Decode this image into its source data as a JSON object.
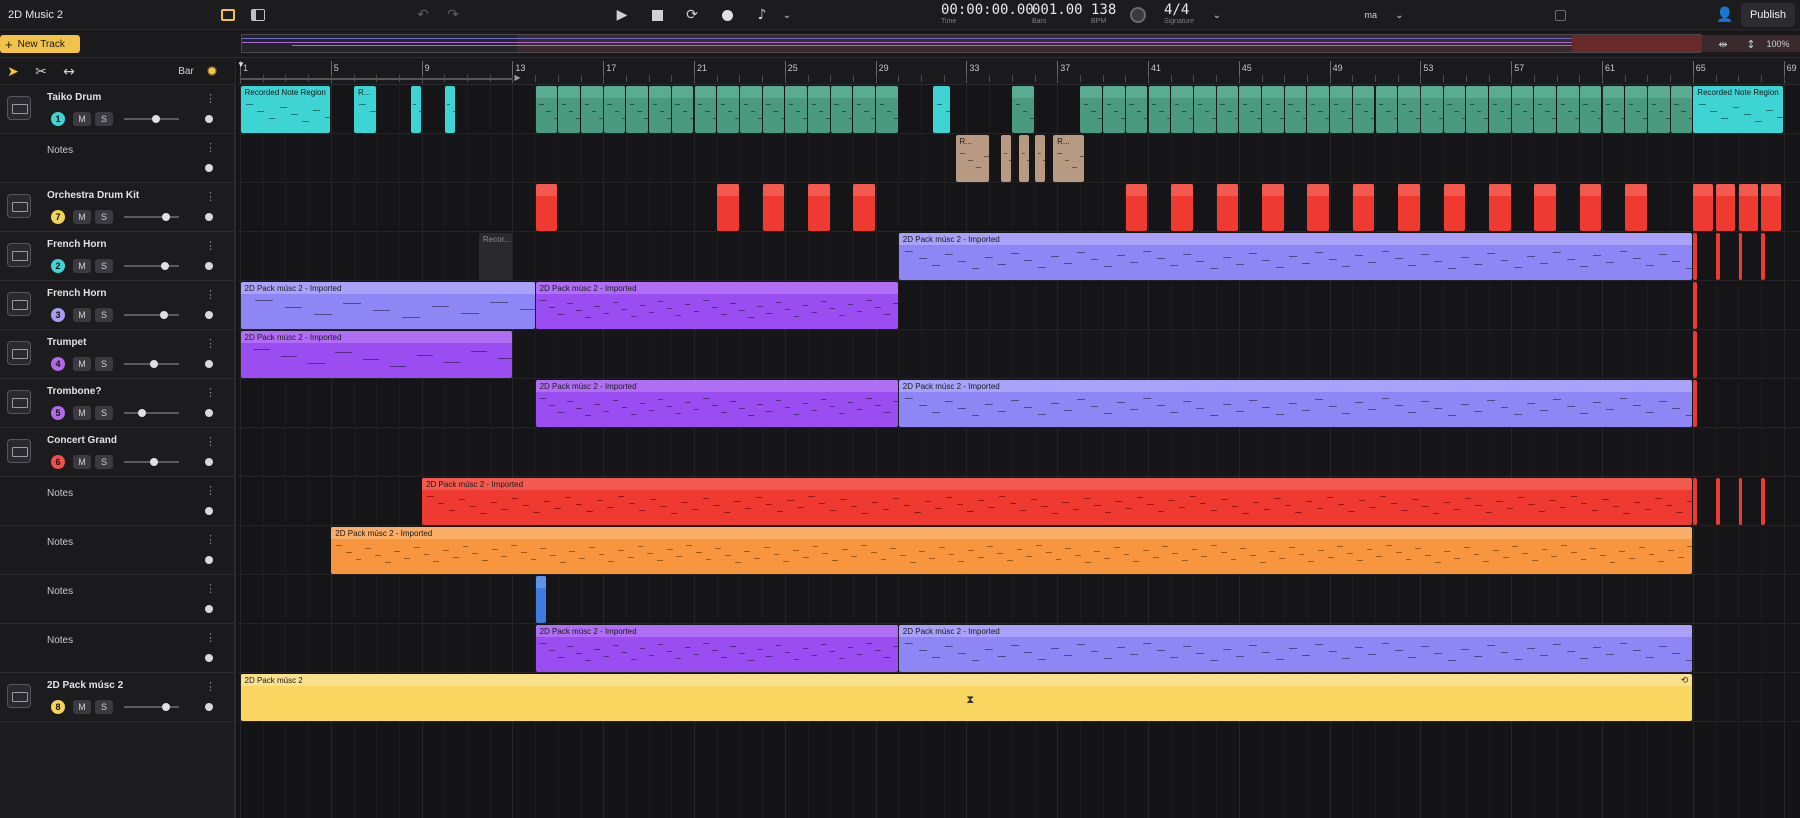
{
  "app": {
    "title": "2D Music 2",
    "publish": "Publish"
  },
  "transport": {
    "time": "00:00:00.00",
    "time_label": "Time",
    "bars": "001.00",
    "bars_label": "Bars",
    "bpm": "138",
    "bpm_label": "BPM",
    "signature": "4/4",
    "signature_label": "Signature",
    "key": "ma"
  },
  "zoom": "100%",
  "new_track": "New Track",
  "snap": "Bar",
  "ruler": [
    "1",
    "5",
    "9",
    "13",
    "17",
    "21",
    "25",
    "29",
    "33",
    "37",
    "41",
    "45",
    "49",
    "53",
    "57",
    "61",
    "65",
    "69"
  ],
  "tracks": [
    {
      "name": "Taiko Drum",
      "num": "1",
      "num_color": "#3fd4d4",
      "icon": true,
      "vol": 0.55
    },
    {
      "name": "Notes",
      "sub": true
    },
    {
      "name": "Orchestra Drum Kit",
      "num": "7",
      "num_color": "#f2d45a",
      "icon": true,
      "vol": 0.75
    },
    {
      "name": "French Horn",
      "num": "2",
      "num_color": "#3fd4d4",
      "icon": true,
      "vol": 0.72
    },
    {
      "name": "French Horn",
      "num": "3",
      "num_color": "#a99cf5",
      "icon": true,
      "vol": 0.7
    },
    {
      "name": "Trumpet",
      "num": "4",
      "num_color": "#b06ae8",
      "icon": true,
      "vol": 0.5
    },
    {
      "name": "Trombone?",
      "num": "5",
      "num_color": "#b06ae8",
      "icon": true,
      "vol": 0.28
    },
    {
      "name": "Concert Grand",
      "num": "6",
      "num_color": "#ef5048",
      "icon": true,
      "vol": 0.5
    },
    {
      "name": "Notes",
      "sub": true
    },
    {
      "name": "Notes",
      "sub": true
    },
    {
      "name": "Notes",
      "sub": true
    },
    {
      "name": "Notes",
      "sub": true
    },
    {
      "name": "2D Pack músc 2",
      "num": "8",
      "num_color": "#f2d45a",
      "icon": true,
      "vol": 0.75
    }
  ],
  "clips": {
    "recorded": "Recorded Note Region",
    "r_short": "R...",
    "imported": "2D Pack músc 2 - Imported",
    "audio": "2D Pack músc 2",
    "recorded_short": "Recor..."
  },
  "colors": {
    "cyan": "#3fd4d4",
    "green": "#4a9a80",
    "tan": "#b89a82",
    "red": "#ee3a30",
    "lavender": "#8f86f5",
    "purple": "#9a4df0",
    "orange": "#f7963f",
    "yellow": "#f8d660",
    "blue": "#3d7ce0"
  }
}
